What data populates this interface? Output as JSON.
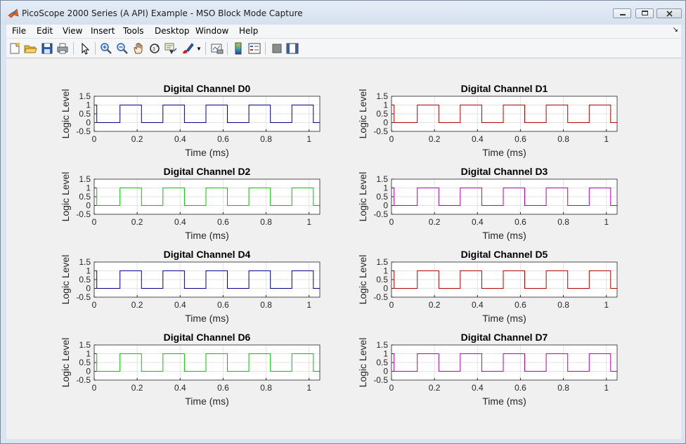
{
  "window": {
    "title": "PicoScope 2000 Series (A API) Example - MSO Block Mode Capture"
  },
  "menu": {
    "items": [
      "File",
      "Edit",
      "View",
      "Insert",
      "Tools",
      "Desktop",
      "Window",
      "Help"
    ]
  },
  "toolbar": {
    "buttons": [
      {
        "name": "new-figure-icon"
      },
      {
        "name": "open-file-icon"
      },
      {
        "name": "save-icon"
      },
      {
        "name": "print-icon"
      },
      {
        "name": "select-arrow-icon"
      },
      {
        "name": "zoom-in-icon"
      },
      {
        "name": "zoom-out-icon"
      },
      {
        "name": "pan-hand-icon"
      },
      {
        "name": "rotate-3d-icon"
      },
      {
        "name": "data-cursor-icon"
      },
      {
        "name": "brush-icon"
      },
      {
        "name": "link-plot-icon"
      },
      {
        "name": "insert-colorbar-icon"
      },
      {
        "name": "insert-legend-icon"
      },
      {
        "name": "hide-plot-tools-icon"
      },
      {
        "name": "show-plot-tools-icon"
      }
    ]
  },
  "chart_data": [
    {
      "type": "line",
      "title": "Digital Channel D0",
      "xlabel": "Time (ms)",
      "ylabel": "Logic Level",
      "color": "#00008b",
      "xlim": [
        0,
        1.05
      ],
      "ylim": [
        -0.5,
        1.5
      ],
      "xticks": [
        "0",
        "0.2",
        "0.4",
        "0.6",
        "0.8",
        "1"
      ],
      "yticks": [
        "1.5",
        "1",
        "0.5",
        "0",
        "-0.5"
      ],
      "pattern": "square wave, period 0.2 ms, high 0-0.012 then low until 0.12, high 0.12-0.22, etc.",
      "x": [
        0,
        0.012,
        0.012,
        0.12,
        0.12,
        0.22,
        0.22,
        0.32,
        0.32,
        0.42,
        0.42,
        0.52,
        0.52,
        0.62,
        0.62,
        0.72,
        0.72,
        0.82,
        0.82,
        0.92,
        0.92,
        1.02,
        1.02,
        1.05
      ],
      "y": [
        1,
        1,
        0,
        0,
        1,
        1,
        0,
        0,
        1,
        1,
        0,
        0,
        1,
        1,
        0,
        0,
        1,
        1,
        0,
        0,
        1,
        1,
        0,
        0
      ]
    },
    {
      "type": "line",
      "title": "Digital Channel D1",
      "xlabel": "Time (ms)",
      "ylabel": "Logic Level",
      "color": "#b20000",
      "xlim": [
        0,
        1.05
      ],
      "ylim": [
        -0.5,
        1.5
      ],
      "xticks": [
        "0",
        "0.2",
        "0.4",
        "0.6",
        "0.8",
        "1"
      ],
      "yticks": [
        "1.5",
        "1",
        "0.5",
        "0",
        "-0.5"
      ],
      "x": [
        0,
        0.012,
        0.012,
        0.12,
        0.12,
        0.22,
        0.22,
        0.32,
        0.32,
        0.42,
        0.42,
        0.52,
        0.52,
        0.62,
        0.62,
        0.72,
        0.72,
        0.82,
        0.82,
        0.92,
        0.92,
        1.02,
        1.02,
        1.05
      ],
      "y": [
        1,
        1,
        0,
        0,
        1,
        1,
        0,
        0,
        1,
        1,
        0,
        0,
        1,
        1,
        0,
        0,
        1,
        1,
        0,
        0,
        1,
        1,
        0,
        0
      ]
    },
    {
      "type": "line",
      "title": "Digital Channel D2",
      "xlabel": "Time (ms)",
      "ylabel": "Logic Level",
      "color": "#00c800",
      "xlim": [
        0,
        1.05
      ],
      "ylim": [
        -0.5,
        1.5
      ],
      "xticks": [
        "0",
        "0.2",
        "0.4",
        "0.6",
        "0.8",
        "1"
      ],
      "yticks": [
        "1.5",
        "1",
        "0.5",
        "0",
        "-0.5"
      ],
      "x": [
        0,
        0.012,
        0.012,
        0.12,
        0.12,
        0.22,
        0.22,
        0.32,
        0.32,
        0.42,
        0.42,
        0.52,
        0.52,
        0.62,
        0.62,
        0.72,
        0.72,
        0.82,
        0.82,
        0.92,
        0.92,
        1.02,
        1.02,
        1.05
      ],
      "y": [
        1,
        1,
        0,
        0,
        1,
        1,
        0,
        0,
        1,
        1,
        0,
        0,
        1,
        1,
        0,
        0,
        1,
        1,
        0,
        0,
        1,
        1,
        0,
        0
      ]
    },
    {
      "type": "line",
      "title": "Digital Channel D3",
      "xlabel": "Time (ms)",
      "ylabel": "Logic Level",
      "color": "#b400b4",
      "xlim": [
        0,
        1.05
      ],
      "ylim": [
        -0.5,
        1.5
      ],
      "xticks": [
        "0",
        "0.2",
        "0.4",
        "0.6",
        "0.8",
        "1"
      ],
      "yticks": [
        "1.5",
        "1",
        "0.5",
        "0",
        "-0.5"
      ],
      "x": [
        0,
        0.012,
        0.012,
        0.12,
        0.12,
        0.22,
        0.22,
        0.32,
        0.32,
        0.42,
        0.42,
        0.52,
        0.52,
        0.62,
        0.62,
        0.72,
        0.72,
        0.82,
        0.82,
        0.92,
        0.92,
        1.02,
        1.02,
        1.05
      ],
      "y": [
        1,
        1,
        0,
        0,
        1,
        1,
        0,
        0,
        1,
        1,
        0,
        0,
        1,
        1,
        0,
        0,
        1,
        1,
        0,
        0,
        1,
        1,
        0,
        0
      ]
    },
    {
      "type": "line",
      "title": "Digital Channel D4",
      "xlabel": "Time (ms)",
      "ylabel": "Logic Level",
      "color": "#00008b",
      "xlim": [
        0,
        1.05
      ],
      "ylim": [
        -0.5,
        1.5
      ],
      "xticks": [
        "0",
        "0.2",
        "0.4",
        "0.6",
        "0.8",
        "1"
      ],
      "yticks": [
        "1.5",
        "1",
        "0.5",
        "0",
        "-0.5"
      ],
      "x": [
        0,
        0.012,
        0.012,
        0.12,
        0.12,
        0.22,
        0.22,
        0.32,
        0.32,
        0.42,
        0.42,
        0.52,
        0.52,
        0.62,
        0.62,
        0.72,
        0.72,
        0.82,
        0.82,
        0.92,
        0.92,
        1.02,
        1.02,
        1.05
      ],
      "y": [
        1,
        1,
        0,
        0,
        1,
        1,
        0,
        0,
        1,
        1,
        0,
        0,
        1,
        1,
        0,
        0,
        1,
        1,
        0,
        0,
        1,
        1,
        0,
        0
      ]
    },
    {
      "type": "line",
      "title": "Digital Channel D5",
      "xlabel": "Time (ms)",
      "ylabel": "Logic Level",
      "color": "#b20000",
      "xlim": [
        0,
        1.05
      ],
      "ylim": [
        -0.5,
        1.5
      ],
      "xticks": [
        "0",
        "0.2",
        "0.4",
        "0.6",
        "0.8",
        "1"
      ],
      "yticks": [
        "1.5",
        "1",
        "0.5",
        "0",
        "-0.5"
      ],
      "x": [
        0,
        0.012,
        0.012,
        0.12,
        0.12,
        0.22,
        0.22,
        0.32,
        0.32,
        0.42,
        0.42,
        0.52,
        0.52,
        0.62,
        0.62,
        0.72,
        0.72,
        0.82,
        0.82,
        0.92,
        0.92,
        1.02,
        1.02,
        1.05
      ],
      "y": [
        1,
        1,
        0,
        0,
        1,
        1,
        0,
        0,
        1,
        1,
        0,
        0,
        1,
        1,
        0,
        0,
        1,
        1,
        0,
        0,
        1,
        1,
        0,
        0
      ]
    },
    {
      "type": "line",
      "title": "Digital Channel D6",
      "xlabel": "Time (ms)",
      "ylabel": "Logic Level",
      "color": "#00c800",
      "xlim": [
        0,
        1.05
      ],
      "ylim": [
        -0.5,
        1.5
      ],
      "xticks": [
        "0",
        "0.2",
        "0.4",
        "0.6",
        "0.8",
        "1"
      ],
      "yticks": [
        "1.5",
        "1",
        "0.5",
        "0",
        "-0.5"
      ],
      "x": [
        0,
        0.012,
        0.012,
        0.12,
        0.12,
        0.22,
        0.22,
        0.32,
        0.32,
        0.42,
        0.42,
        0.52,
        0.52,
        0.62,
        0.62,
        0.72,
        0.72,
        0.82,
        0.82,
        0.92,
        0.92,
        1.02,
        1.02,
        1.05
      ],
      "y": [
        1,
        1,
        0,
        0,
        1,
        1,
        0,
        0,
        1,
        1,
        0,
        0,
        1,
        1,
        0,
        0,
        1,
        1,
        0,
        0,
        1,
        1,
        0,
        0
      ]
    },
    {
      "type": "line",
      "title": "Digital Channel D7",
      "xlabel": "Time (ms)",
      "ylabel": "Logic Level",
      "color": "#b400b4",
      "xlim": [
        0,
        1.05
      ],
      "ylim": [
        -0.5,
        1.5
      ],
      "xticks": [
        "0",
        "0.2",
        "0.4",
        "0.6",
        "0.8",
        "1"
      ],
      "yticks": [
        "1.5",
        "1",
        "0.5",
        "0",
        "-0.5"
      ],
      "x": [
        0,
        0.012,
        0.012,
        0.12,
        0.12,
        0.22,
        0.22,
        0.32,
        0.32,
        0.42,
        0.42,
        0.52,
        0.52,
        0.62,
        0.62,
        0.72,
        0.72,
        0.82,
        0.82,
        0.92,
        0.92,
        1.02,
        1.02,
        1.05
      ],
      "y": [
        1,
        1,
        0,
        0,
        1,
        1,
        0,
        0,
        1,
        1,
        0,
        0,
        1,
        1,
        0,
        0,
        1,
        1,
        0,
        0,
        1,
        1,
        0,
        0
      ]
    }
  ]
}
